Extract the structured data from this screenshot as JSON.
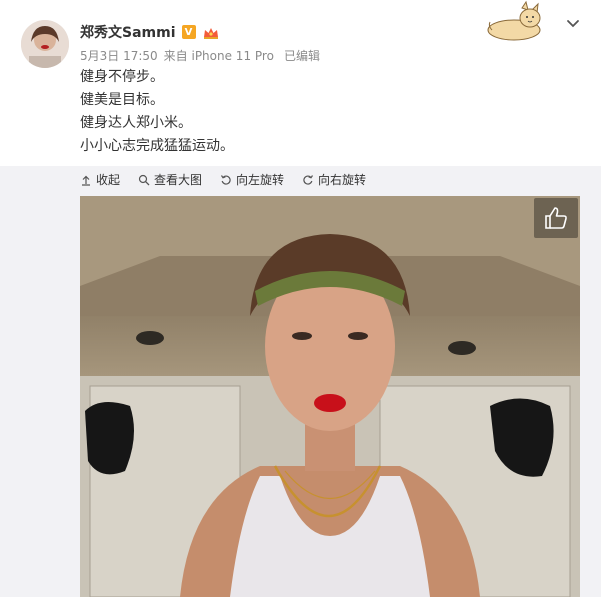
{
  "post": {
    "username": "郑秀文Sammi",
    "vip_badge": "V",
    "date": "5月3日 17:50",
    "source": "来自 iPhone 11 Pro",
    "edited": "已编辑",
    "lines": [
      "健身不停步。",
      "健美是目标。",
      "健身达人郑小米。",
      "小小心志完成猛猛运动。"
    ]
  },
  "toolbar": {
    "collapse": "收起",
    "view_large": "查看大图",
    "rotate_left": "向左旋转",
    "rotate_right": "向右旋转"
  },
  "icons": {
    "collapse": "collapse-icon",
    "zoom": "magnifier-icon",
    "rotate_left": "rotate-left-icon",
    "rotate_right": "rotate-right-icon",
    "like": "thumbs-up-icon",
    "menu": "chevron-down-icon"
  },
  "colors": {
    "vip": "#f5a623",
    "text": "#333333",
    "meta": "#8a8a8a",
    "panel": "#f2f2f5"
  }
}
